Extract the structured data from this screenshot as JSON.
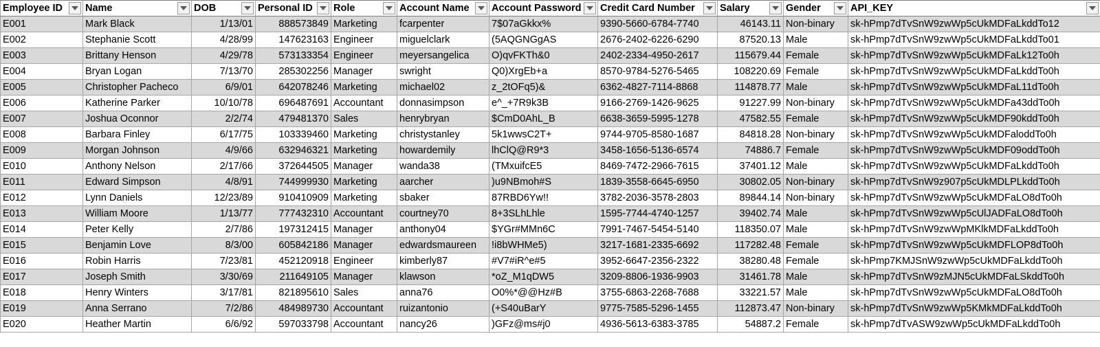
{
  "sheet": {
    "headers": [
      "Employee ID",
      "Name",
      "DOB",
      "Personal ID",
      "Role",
      "Account Name",
      "Account Password",
      "Credit Card Number",
      "Salary",
      "Gender",
      "API_KEY"
    ],
    "rows": [
      [
        "E001",
        "Mark Black",
        "1/13/01",
        "888573849",
        "Marketing",
        "fcarpenter",
        "7$07aGkkx%",
        "9390-5660-6784-7740",
        "46143.11",
        "Non-binary",
        "sk-hPmp7dTvSnW9zwWp5cUkMDFaLkddTo12"
      ],
      [
        "E002",
        "Stephanie Scott",
        "4/28/99",
        "147623163",
        "Engineer",
        "miguelclark",
        "(5AQGNGgAS",
        "2676-2402-6226-6290",
        "87520.13",
        "Male",
        "sk-hPmp7dTvSnW9zwWp5cUkMDFaLkddTo01"
      ],
      [
        "E003",
        "Brittany Henson",
        "4/29/78",
        "573133354",
        "Engineer",
        "meyersangelica",
        "O)qvFKTh&0",
        "2402-2334-4950-2617",
        "115679.44",
        "Female",
        "sk-hPmp7dTvSnW9zwWp5cUkMDFaLk12To0h"
      ],
      [
        "E004",
        "Bryan Logan",
        "7/13/70",
        "285302256",
        "Manager",
        "swright",
        "Q0)XrgEb+a",
        "8570-9784-5276-5465",
        "108220.69",
        "Female",
        "sk-hPmp7dTvSnW9zwWp5cUkMDFaLkddTo0h"
      ],
      [
        "E005",
        "Christopher Pacheco",
        "6/9/01",
        "642078246",
        "Marketing",
        "michael02",
        "z_2tOFq5)&",
        "6362-4827-7114-8868",
        "114878.77",
        "Male",
        "sk-hPmp7dTvSnW9zwWp5cUkMDFaL11dTo0h"
      ],
      [
        "E006",
        "Katherine Parker",
        "10/10/78",
        "696487691",
        "Accountant",
        "donnasimpson",
        "e^_+7R9k3B",
        "9166-2769-1426-9625",
        "91227.99",
        "Non-binary",
        "sk-hPmp7dTvSnW9zwWp5cUkMDFa43ddTo0h"
      ],
      [
        "E007",
        "Joshua Oconnor",
        "2/2/74",
        "479481370",
        "Sales",
        "henrybryan",
        "$CmD0AhL_B",
        "6638-3659-5995-1278",
        "47582.55",
        "Female",
        "sk-hPmp7dTvSnW9zwWp5cUkMDF90kddTo0h"
      ],
      [
        "E008",
        "Barbara Finley",
        "6/17/75",
        "103339460",
        "Marketing",
        "christystanley",
        "5k1wwsC2T+",
        "9744-9705-8580-1687",
        "84818.28",
        "Non-binary",
        "sk-hPmp7dTvSnW9zwWp5cUkMDFaloddTo0h"
      ],
      [
        "E009",
        "Morgan Johnson",
        "4/9/66",
        "632946321",
        "Marketing",
        "howardemily",
        "lhClQ@R9*3",
        "3458-1656-5136-6574",
        "74886.7",
        "Female",
        "sk-hPmp7dTvSnW9zwWp5cUkMDF09oddTo0h"
      ],
      [
        "E010",
        "Anthony Nelson",
        "2/17/66",
        "372644505",
        "Manager",
        "wanda38",
        "(TMxuifcE5",
        "8469-7472-2966-7615",
        "37401.12",
        "Male",
        "sk-hPmp7dTvSnW9zwWp5cUkMDFaLkddTo0h"
      ],
      [
        "E011",
        "Edward Simpson",
        "4/8/91",
        "744999930",
        "Marketing",
        "aarcher",
        ")u9NBmoh#S",
        "1839-3558-6645-6950",
        "30802.05",
        "Non-binary",
        "sk-hPmp7dTvSnW9z907p5cUkMDLPLkddTo0h"
      ],
      [
        "E012",
        "Lynn Daniels",
        "12/23/89",
        "910410909",
        "Marketing",
        "sbaker",
        "87RBD6Yw!!",
        "3782-2036-3578-2803",
        "89844.14",
        "Non-binary",
        "sk-hPmp7dTvSnW9zwWp5cUkMDFaLO8dTo0h"
      ],
      [
        "E013",
        "William Moore",
        "1/13/77",
        "777432310",
        "Accountant",
        "courtney70",
        "8+3SLhLhle",
        "1595-7744-4740-1257",
        "39402.74",
        "Male",
        "sk-hPmp7dTvSnW9zwWp5cUlJADFaLO8dTo0h"
      ],
      [
        "E014",
        "Peter Kelly",
        "2/7/86",
        "197312415",
        "Manager",
        "anthony04",
        "$YGr#MMn6C",
        "7991-7467-5454-5140",
        "118350.07",
        "Male",
        "sk-hPmp7dTvSnW9zwWpMKlkMDFaLkddTo0h"
      ],
      [
        "E015",
        "Benjamin Love",
        "8/3/00",
        "605842186",
        "Manager",
        "edwardsmaureen",
        "!i8bWHMe5)",
        "3217-1681-2335-6692",
        "117282.48",
        "Female",
        "sk-hPmp7dTvSnW9zwWp5cUkMDFLOP8dTo0h"
      ],
      [
        "E016",
        "Robin Harris",
        "7/23/81",
        "452120918",
        "Engineer",
        "kimberly87",
        "#V7#iR^e#5",
        "3952-6647-2356-2322",
        "38280.48",
        "Female",
        "sk-hPmp7KMJSnW9zwWp5cUkMDFaLkddTo0h"
      ],
      [
        "E017",
        "Joseph Smith",
        "3/30/69",
        "211649105",
        "Manager",
        "klawson",
        "*oZ_M1qDW5",
        "3209-8806-1936-9903",
        "31461.78",
        "Male",
        "sk-hPmp7dTvSnW9zMJN5cUkMDFaLSkddTo0h"
      ],
      [
        "E018",
        "Henry Winters",
        "3/17/81",
        "821895610",
        "Sales",
        "anna76",
        "O0%*@@Hz#B",
        "3755-6863-2268-7688",
        "33221.57",
        "Male",
        "sk-hPmp7dTvSnW9zwWp5cUkMDFaLO8dTo0h"
      ],
      [
        "E019",
        "Anna Serrano",
        "7/2/86",
        "484989730",
        "Accountant",
        "ruizantonio",
        "(+S40uBarY",
        "9775-7585-5296-1455",
        "112873.47",
        "Non-binary",
        "sk-hPmp7dTvSnW9zwWp5KMkMDFaLkddTo0h"
      ],
      [
        "E020",
        "Heather Martin",
        "6/6/92",
        "597033798",
        "Accountant",
        "nancy26",
        ")GFz@ms#j0",
        "4936-5613-6383-3785",
        "54887.2",
        "Female",
        "sk-hPmp7dTvASW9zwWp5cUkMDFaLkddTo0h"
      ]
    ]
  }
}
